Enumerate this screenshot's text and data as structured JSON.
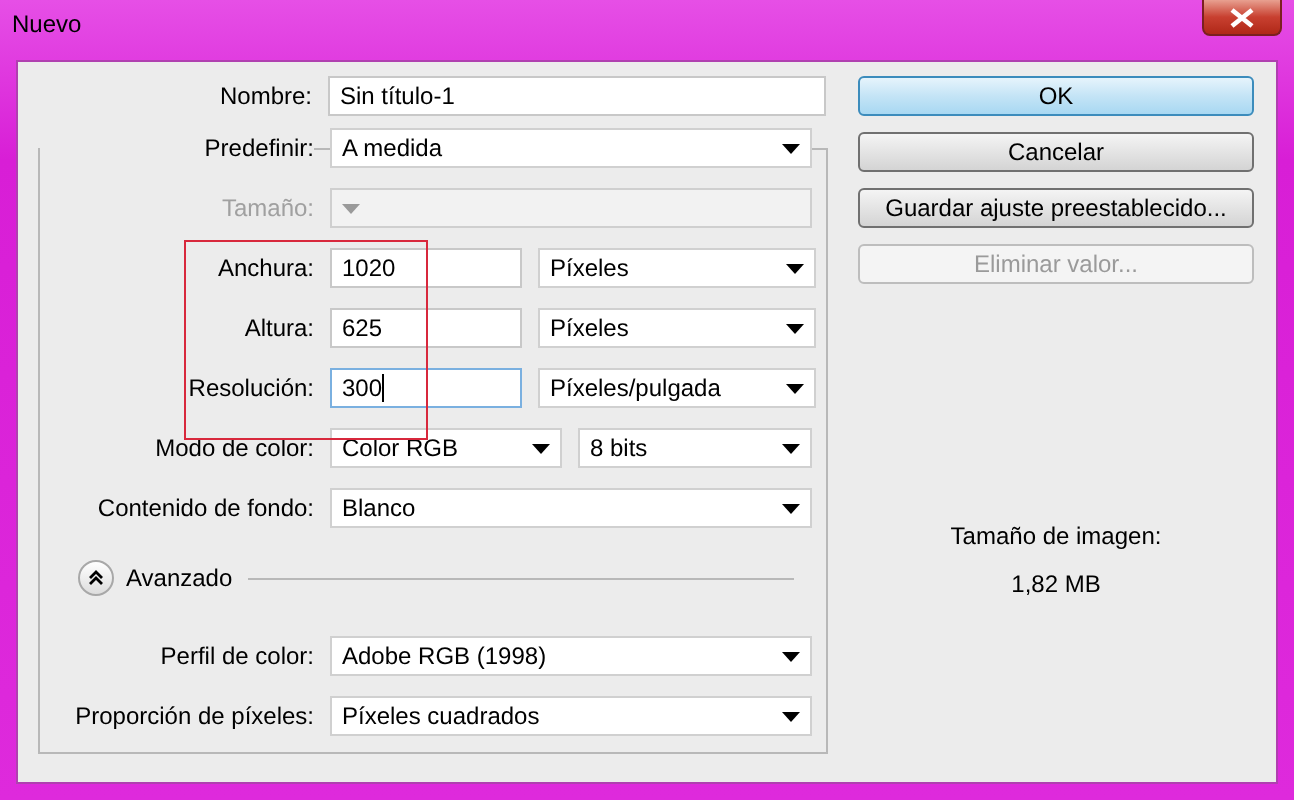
{
  "window": {
    "title": "Nuevo"
  },
  "name_row": {
    "label": "Nombre:",
    "value": "Sin título-1"
  },
  "preset_rows": [
    {
      "kind": "select",
      "label": "Predefinir:",
      "value": "A medida",
      "disabled": false
    },
    {
      "kind": "select",
      "label": "Tamaño:",
      "disabled": true
    },
    {
      "kind": "value_unit",
      "label": "Anchura:",
      "value": "1020",
      "unit": "Píxeles",
      "highlighted": true,
      "focused": false
    },
    {
      "kind": "value_unit",
      "label": "Altura:",
      "value": "625",
      "unit": "Píxeles",
      "highlighted": true,
      "focused": false
    },
    {
      "kind": "value_unit",
      "label": "Resolución:",
      "value": "300",
      "unit": "Píxeles/pulgada",
      "highlighted": true,
      "focused": true
    },
    {
      "kind": "two_selects",
      "label": "Modo de color:",
      "value": "Color RGB",
      "unit": "8 bits"
    },
    {
      "kind": "select",
      "label": "Contenido de fondo:",
      "value": "Blanco",
      "disabled": false
    }
  ],
  "advanced": {
    "label": "Avanzado",
    "expanded": true,
    "rows": [
      {
        "label": "Perfil de color:",
        "value": "Adobe RGB (1998)"
      },
      {
        "label": "Proporción de píxeles:",
        "value": "Píxeles cuadrados"
      }
    ]
  },
  "buttons": [
    {
      "label": "OK",
      "default": true,
      "disabled": false
    },
    {
      "label": "Cancelar",
      "default": false,
      "disabled": false
    },
    {
      "label": "Guardar ajuste preestablecido...",
      "default": false,
      "disabled": false
    },
    {
      "label": "Eliminar valor...",
      "default": false,
      "disabled": true
    }
  ],
  "image_size": {
    "label": "Tamaño de imagen:",
    "value": "1,82 MB"
  }
}
